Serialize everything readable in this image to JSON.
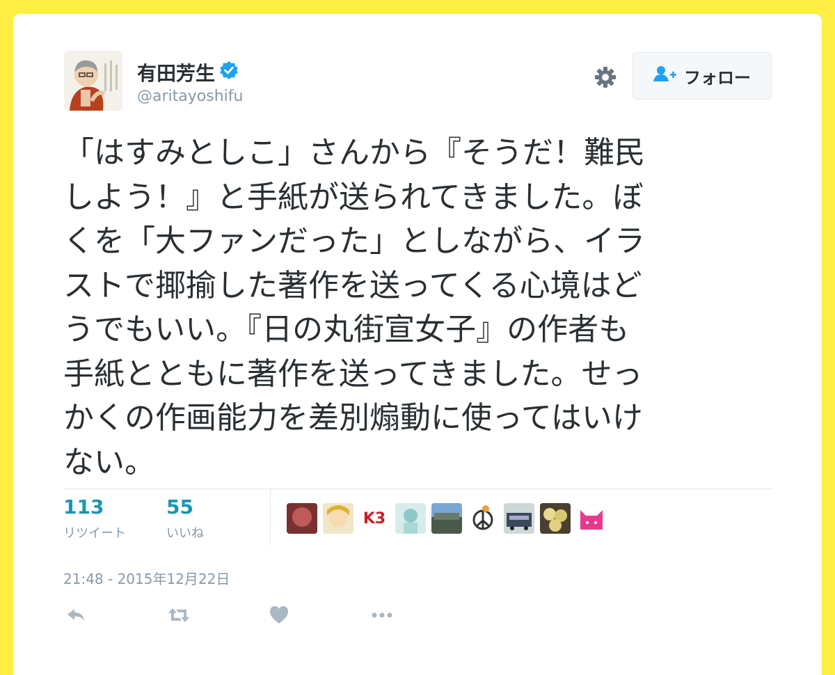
{
  "user": {
    "display_name": "有田芳生",
    "handle": "@aritayoshifu"
  },
  "follow_button": {
    "label": "フォロー"
  },
  "tweet": {
    "text": "「はすみとしこ」さんから『そうだ！難民\nしよう！』と手紙が送られてきました。ぼ\nくを「大ファンだった」としながら、イラ\nストで揶揄した著作を送ってくる心境はど\nうでもいい。『日の丸街宣女子』の作者も\n手紙とともに著作を送ってきました。せっ\nかくの作画能力を差別煽動に使ってはいけ\nない。"
  },
  "stats": {
    "retweets": {
      "count": "113",
      "label": "リツイート"
    },
    "likes": {
      "count": "55",
      "label": "いいね"
    }
  },
  "likers": {
    "k3_label": "K3"
  },
  "timestamp": "21:48 - 2015年12月22日",
  "colors": {
    "page_background": "#ffee44",
    "accent": "#1b95b0",
    "verified": "#1da1f2",
    "muted": "#8899a6"
  },
  "icons": [
    "verified-icon",
    "gear-icon",
    "follow-person-icon",
    "reply-icon",
    "retweet-icon",
    "like-icon",
    "more-icon"
  ]
}
